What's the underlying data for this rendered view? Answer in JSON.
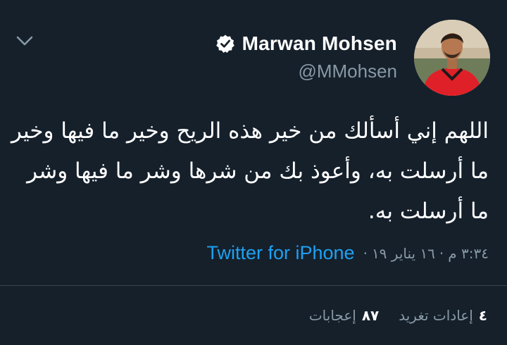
{
  "user": {
    "display_name": "Marwan Mohsen",
    "handle": "@MMohsen",
    "verified": true
  },
  "tweet": {
    "text": "اللهم إني أسألك من خير هذه الريح وخير ما فيها وخير ما أرسلت به، وأعوذ بك من شرها وشر ما فيها وشر ما أرسلت به."
  },
  "meta": {
    "time": "٣:٣٤ م",
    "separator": "·",
    "date": "١٦ يناير ١٩",
    "source": "Twitter for iPhone"
  },
  "stats": {
    "retweets_count": "٤",
    "retweets_label": "إعادات تغريد",
    "likes_count": "٨٧",
    "likes_label": "إعجابات"
  },
  "icons": {
    "menu": "chevron-down-icon",
    "verified": "verified-badge-icon"
  },
  "colors": {
    "background": "#15202b",
    "text": "#ffffff",
    "secondary": "#8899a6",
    "link": "#1da1f2",
    "divider": "#38444d"
  }
}
